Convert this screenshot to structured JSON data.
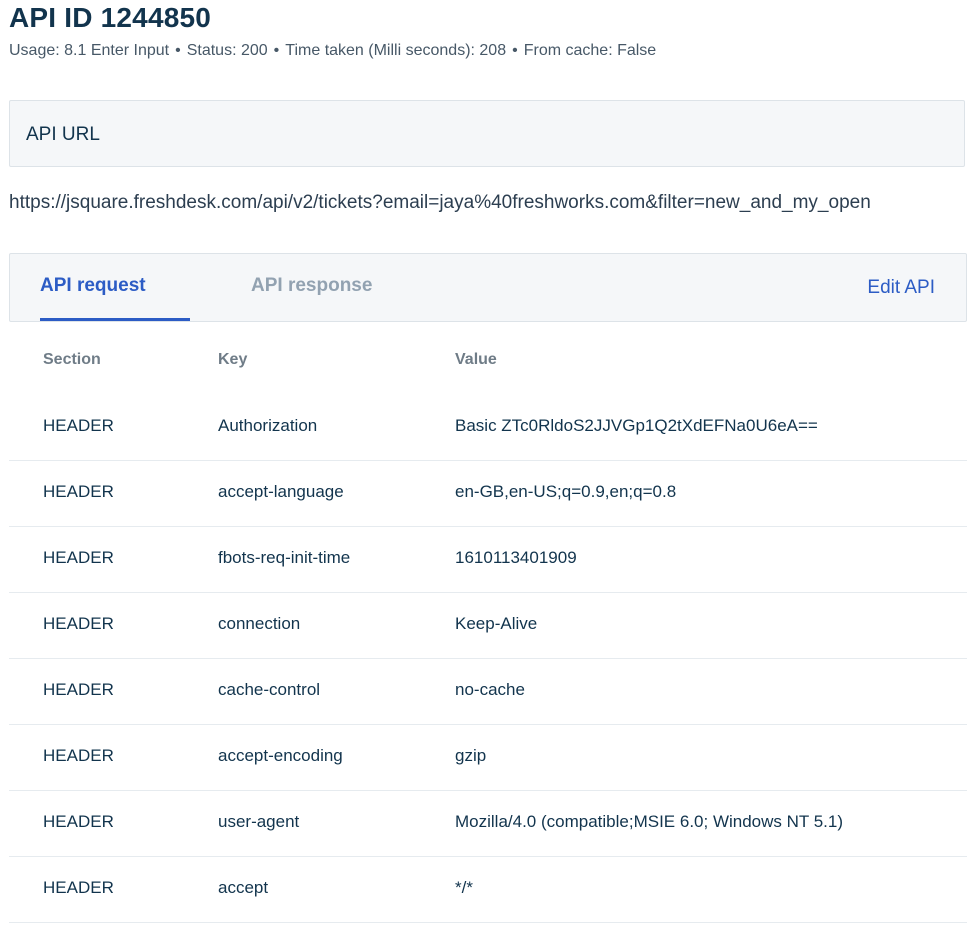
{
  "header": {
    "title": "API ID 1244850",
    "meta": {
      "usage": "Usage: 8.1 Enter Input",
      "status": "Status: 200",
      "time": "Time taken (Milli seconds): 208",
      "cache": "From cache: False",
      "separator": "•"
    }
  },
  "api_url": {
    "label": "API URL",
    "value": "https://jsquare.freshdesk.com/api/v2/tickets?email=jaya%40freshworks.com&filter=new_and_my_open"
  },
  "tabs": {
    "request": "API request",
    "response": "API response",
    "active": "request",
    "edit_label": "Edit API"
  },
  "table": {
    "headers": {
      "section": "Section",
      "key": "Key",
      "value": "Value"
    },
    "rows": [
      {
        "section": "HEADER",
        "key": "Authorization",
        "value": "Basic ZTc0RldoS2JJVGp1Q2tXdEFNa0U6eA=="
      },
      {
        "section": "HEADER",
        "key": "accept-language",
        "value": "en-GB,en-US;q=0.9,en;q=0.8"
      },
      {
        "section": "HEADER",
        "key": "fbots-req-init-time",
        "value": "1610113401909"
      },
      {
        "section": "HEADER",
        "key": "connection",
        "value": "Keep-Alive"
      },
      {
        "section": "HEADER",
        "key": "cache-control",
        "value": "no-cache"
      },
      {
        "section": "HEADER",
        "key": "accept-encoding",
        "value": "gzip"
      },
      {
        "section": "HEADER",
        "key": "user-agent",
        "value": "Mozilla/4.0 (compatible;MSIE 6.0; Windows NT 5.1)"
      },
      {
        "section": "HEADER",
        "key": "accept",
        "value": "*/*"
      }
    ]
  }
}
